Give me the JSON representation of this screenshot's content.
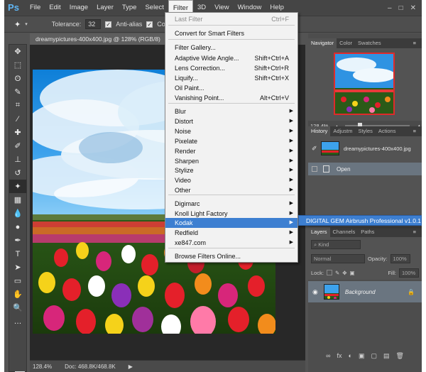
{
  "app": {
    "logo": "Ps"
  },
  "menubar": {
    "items": [
      "File",
      "Edit",
      "Image",
      "Layer",
      "Type",
      "Select",
      "Filter",
      "3D",
      "View",
      "Window",
      "Help"
    ],
    "active": "Filter",
    "window_controls": [
      "–",
      "□",
      "✕"
    ]
  },
  "options": {
    "tolerance_label": "Tolerance:",
    "tolerance_value": "32",
    "antialias_label": "Anti-alias",
    "contiguous_label": "Contigu"
  },
  "document": {
    "tab_title": "dreamypictures-400x400.jpg @ 128% (RGB/8)",
    "tab_close": "×"
  },
  "status": {
    "zoom": "128.4%",
    "doc": "Doc: 468.8K/468.8K",
    "arrow": "▶"
  },
  "filter_menu": {
    "items": [
      {
        "label": "Last Filter",
        "shortcut": "Ctrl+F",
        "disabled": true
      },
      {
        "label": "Convert for Smart Filters"
      },
      {
        "label": "Filter Gallery..."
      },
      {
        "label": "Adaptive Wide Angle...",
        "shortcut": "Shift+Ctrl+A"
      },
      {
        "label": "Lens Correction...",
        "shortcut": "Shift+Ctrl+R"
      },
      {
        "label": "Liquify...",
        "shortcut": "Shift+Ctrl+X"
      },
      {
        "label": "Oil Paint..."
      },
      {
        "label": "Vanishing Point...",
        "shortcut": "Alt+Ctrl+V"
      },
      {
        "label": "Blur",
        "submenu": true
      },
      {
        "label": "Distort",
        "submenu": true
      },
      {
        "label": "Noise",
        "submenu": true
      },
      {
        "label": "Pixelate",
        "submenu": true
      },
      {
        "label": "Render",
        "submenu": true
      },
      {
        "label": "Sharpen",
        "submenu": true
      },
      {
        "label": "Stylize",
        "submenu": true
      },
      {
        "label": "Video",
        "submenu": true
      },
      {
        "label": "Other",
        "submenu": true
      },
      {
        "label": "Digimarc",
        "submenu": true
      },
      {
        "label": "Knoll Light Factory",
        "submenu": true
      },
      {
        "label": "Kodak",
        "submenu": true,
        "highlighted": true
      },
      {
        "label": "Redfield",
        "submenu": true
      },
      {
        "label": "xe847.com",
        "submenu": true
      },
      {
        "label": "Browse Filters Online..."
      }
    ],
    "submenu_glyph": "▶"
  },
  "kodak_submenu": {
    "item": "DIGITAL GEM Airbrush Professional v1.0.1"
  },
  "panels": {
    "navigator": {
      "tabs": [
        "Navigator",
        "Color",
        "Swatches"
      ],
      "zoom": "128.4%",
      "menu_glyph": "≡",
      "zoom_out": "▴",
      "zoom_in": "▲"
    },
    "history": {
      "tabs": [
        "History",
        "Adjustm",
        "Styles",
        "Actions"
      ],
      "snapshot": "dreamypictures-400x400.jpg",
      "state": "Open",
      "menu_glyph": "≡"
    },
    "layers": {
      "tabs": [
        "Layers",
        "Channels",
        "Paths"
      ],
      "kind_label": "Kind",
      "blend_mode": "Normal",
      "opacity_label": "Opacity:",
      "opacity_value": "100%",
      "lock_label": "Lock:",
      "fill_label": "Fill:",
      "fill_value": "100%",
      "layer_name": "Background",
      "menu_glyph": "≡",
      "lock_glyph": "🔒",
      "bottom_icons": [
        "∞",
        "fx",
        "◐",
        "▣",
        "▢",
        "▤",
        "🗑"
      ]
    }
  },
  "colors": {
    "fg": "#33cc33",
    "bg": "#ffffff",
    "highlight": "#3d7fd1"
  }
}
